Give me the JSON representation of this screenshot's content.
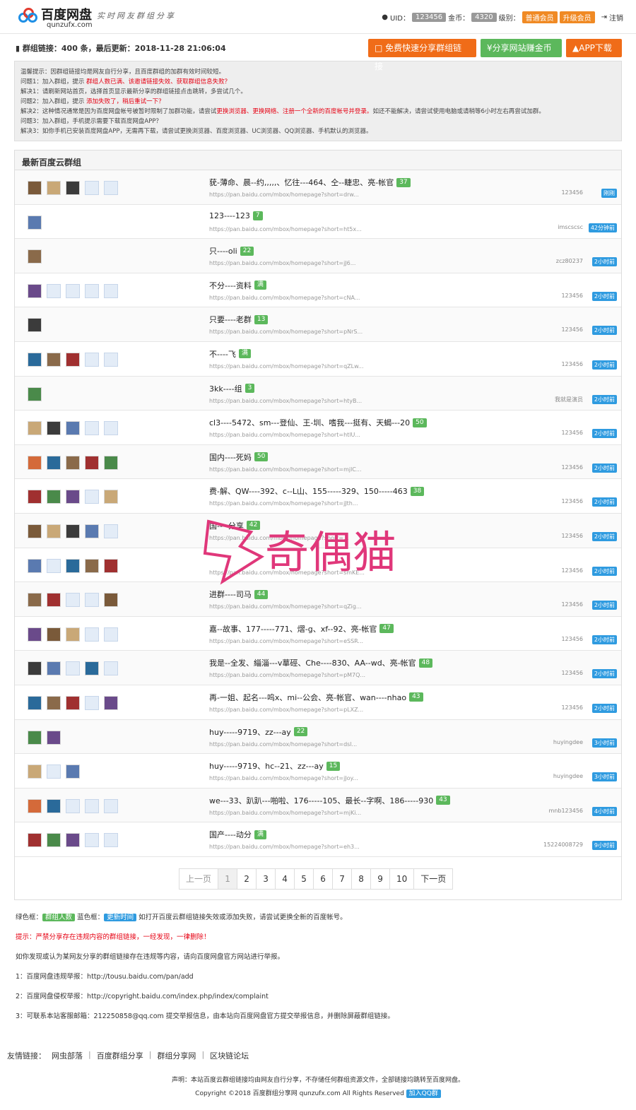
{
  "header": {
    "logo_title": "百度网盘",
    "logo_sub": "qunzufx.com",
    "slogan": "实时网友群组分享",
    "uid_label": "UID：",
    "uid": "123456",
    "coin_label": "金币：",
    "coins": "4320",
    "level_label": "级别：",
    "level": "普通会员",
    "upgrade": "升级会员",
    "logout": "注销"
  },
  "stats": {
    "text": "群组链接：400 条，最后更新：2018-11-28 21:06:04"
  },
  "top_buttons": {
    "share": "免费快速分享群组链接",
    "earn": "¥分享网站赚金币",
    "app": "APP下载"
  },
  "notice": [
    {
      "a": "温馨提示：因群组链接均是网友自行分享，且百度群组的加群有效时间较短。",
      "r": "",
      "b": ""
    },
    {
      "a": "问题1：加入群组，提示 ",
      "r": "群组人数已满、该邀请链接失效、获取群组信息失败？",
      "b": ""
    },
    {
      "a": "解决1：请刷新网站首页，选择首页显示最新分享的群组链接点击跳转，多尝试几个。",
      "r": "",
      "b": ""
    },
    {
      "a": "问题2：加入群组，提示 ",
      "r": "添加失败了，稍后重试一下？",
      "b": ""
    },
    {
      "a": "解决2：这种情况通常是因为百度网盘帐号被暂时限制了加群功能，请尝试",
      "r": "更换浏览器、更换网络、注册一个全新的百度帐号并登录。",
      "b": "如还不能解决，请尝试使用电脑或请稍等6小时左右再尝试加群。"
    },
    {
      "a": "问题3：加入群组，手机提示需要下载百度网盘APP？",
      "r": "",
      "b": ""
    },
    {
      "a": "解决3：如你手机已安装百度网盘APP，无需再下载，请尝试更换浏览器、百度浏览器、UC浏览器、QQ浏览器、手机默认的浏览器。",
      "r": "",
      "b": ""
    }
  ],
  "panel_title": "最新百度云群组",
  "groups": [
    {
      "name": "莸-薄命、晨--约,,,,,、忆往---464、仝--睫忠、亮-帐官",
      "count": "37",
      "link": "https://pan.baidu.com/mbox/homepage?short=drw...",
      "user": "123456",
      "time": "刚刚",
      "av": [
        "img",
        "img",
        "img",
        "blank",
        "blank"
      ]
    },
    {
      "name": "123----123",
      "count": "7",
      "link": "https://pan.baidu.com/mbox/homepage?short=ht5x...",
      "user": "imscscsc",
      "time": "42分钟前",
      "av": [
        "img"
      ]
    },
    {
      "name": "只----oli",
      "count": "22",
      "link": "https://pan.baidu.com/mbox/homepage?short=jJ6...",
      "user": "zcz80237",
      "time": "2小时前",
      "av": [
        "img"
      ]
    },
    {
      "name": "不分----资料",
      "count": "满",
      "link": "https://pan.baidu.com/mbox/homepage?short=cNA...",
      "user": "123456",
      "time": "2小时前",
      "av": [
        "img",
        "blank",
        "blank",
        "blank",
        "blank"
      ]
    },
    {
      "name": "只要----老群",
      "count": "13",
      "link": "https://pan.baidu.com/mbox/homepage?short=pNrS...",
      "user": "123456",
      "time": "2小时前",
      "av": [
        "img"
      ]
    },
    {
      "name": "不----飞",
      "count": "满",
      "link": "https://pan.baidu.com/mbox/homepage?short=qZLw...",
      "user": "123456",
      "time": "2小时前",
      "av": [
        "img",
        "img",
        "img",
        "blank",
        "blank"
      ]
    },
    {
      "name": "3kk----组",
      "count": "3",
      "link": "https://pan.baidu.com/mbox/homepage?short=htyB...",
      "user": "我就是演员",
      "time": "2小时前",
      "av": [
        "img"
      ]
    },
    {
      "name": "cl3----5472、sm---登仙、王-圳、嗜我---挺有、天蝎---20",
      "count": "50",
      "link": "https://pan.baidu.com/mbox/homepage?short=htlU...",
      "user": "123456",
      "time": "2小时前",
      "av": [
        "img",
        "img",
        "img",
        "blank",
        "blank"
      ]
    },
    {
      "name": "国内----死妈",
      "count": "50",
      "link": "https://pan.baidu.com/mbox/homepage?short=mjlC...",
      "user": "123456",
      "time": "2小时前",
      "av": [
        "img",
        "img",
        "img",
        "img",
        "img"
      ]
    },
    {
      "name": "费-解、QW----392、c--L山、155-----329、150-----463",
      "count": "38",
      "link": "https://pan.baidu.com/mbox/homepage?short=jJth...",
      "user": "123456",
      "time": "2小时前",
      "av": [
        "img",
        "img",
        "img",
        "blank",
        "img"
      ]
    },
    {
      "name": "国----分享",
      "count": "42",
      "link": "https://pan.baidu.com/mbox/homepage?short=...",
      "user": "123456",
      "time": "2小时前",
      "av": [
        "img",
        "img",
        "img",
        "img",
        "blank"
      ]
    },
    {
      "name": "",
      "count": "",
      "link": "https://pan.baidu.com/mbox/homepage?short=smKE...",
      "user": "123456",
      "time": "2小时前",
      "av": [
        "img",
        "blank",
        "img",
        "img",
        "img"
      ]
    },
    {
      "name": "进群----司马",
      "count": "44",
      "link": "https://pan.baidu.com/mbox/homepage?short=qZig...",
      "user": "123456",
      "time": "2小时前",
      "av": [
        "img",
        "img",
        "blank",
        "blank",
        "img"
      ]
    },
    {
      "name": "嘉--故事、177-----771、熠-g、xf--92、亮-帐官",
      "count": "47",
      "link": "https://pan.baidu.com/mbox/homepage?short=eSSR...",
      "user": "123456",
      "time": "2小时前",
      "av": [
        "img",
        "img",
        "img",
        "blank",
        "blank"
      ]
    },
    {
      "name": "我是--全发、緇淄---v蕐硜、Che----830、AA--wd、亮-帐官",
      "count": "48",
      "link": "https://pan.baidu.com/mbox/homepage?short=pM7Q...",
      "user": "123456",
      "time": "2小时前",
      "av": [
        "img",
        "img",
        "blank",
        "img",
        "blank"
      ]
    },
    {
      "name": "再-一姐、起名---呜x、mi--公会、亮-帐官、wan----nhao",
      "count": "43",
      "link": "https://pan.baidu.com/mbox/homepage?short=pLXZ...",
      "user": "123456",
      "time": "2小时前",
      "av": [
        "img",
        "img",
        "img",
        "blank",
        "img"
      ]
    },
    {
      "name": "huy-----9719、zz---ay",
      "count": "22",
      "link": "https://pan.baidu.com/mbox/homepage?short=dsl...",
      "user": "huyingdee",
      "time": "3小时前",
      "av": [
        "img",
        "img"
      ]
    },
    {
      "name": "huy-----9719、hc--21、zz---ay",
      "count": "15",
      "link": "https://pan.baidu.com/mbox/homepage?short=jJoy...",
      "user": "huyingdee",
      "time": "3小时前",
      "av": [
        "img",
        "blank",
        "img"
      ]
    },
    {
      "name": "we---33、趴趴---啪啦、176-----105、最长--字啊、186-----930",
      "count": "43",
      "link": "https://pan.baidu.com/mbox/homepage?short=mjKi...",
      "user": "mnb123456",
      "time": "4小时前",
      "av": [
        "img",
        "img",
        "blank",
        "blank",
        "blank"
      ]
    },
    {
      "name": "国产----动分",
      "count": "满",
      "link": "https://pan.baidu.com/mbox/homepage?short=eh3...",
      "user": "15224008729",
      "time": "9小时前",
      "av": [
        "img",
        "img",
        "img",
        "blank",
        "blank"
      ]
    }
  ],
  "pager": {
    "prev": "上一页",
    "next": "下一页",
    "pages": [
      "1",
      "2",
      "3",
      "4",
      "5",
      "6",
      "7",
      "8",
      "9",
      "10"
    ]
  },
  "notes": {
    "legend_a": "绿色框：",
    "legend_g": "群组人数",
    "legend_b": "蓝色框：",
    "legend_bl": "更新时间",
    "legend_c": "如打开百度云群组链接失效或添加失败，请尝试更换全新的百度帐号。",
    "warn": "提示：严禁分享存在违规内容的群组链接，一经发现，一律删除！",
    "line3": "如你发现或认为某网友分享的群组链接存在违规等内容，请向百度网盘官方网站进行举报。",
    "line4": "1：百度网盘违规举报：http://tousu.baidu.com/pan/add",
    "line5": "2：百度网盘侵权举报：http://copyright.baidu.com/index.php/index/complaint",
    "line6": "3：可联系本站客服邮箱：212250858@qq.com 提交举报信息，由本站向百度网盘官方提交举报信息，并删除屏蔽群组链接。"
  },
  "friends": {
    "label": "友情链接：",
    "links": [
      "网虫部落",
      "百度群组分享",
      "群组分享网",
      "区块链论坛"
    ]
  },
  "footer": {
    "statement": "声明：本站百度云群组链接均由网友自行分享，不存储任何群组资源文件，全部链接均跳转至百度网盘。",
    "copyright": "Copyright ©2018 百度群组分享网 qunzufx.com All Rights Reserved",
    "qq": "加入QQ群"
  },
  "watermark": "奇偶猫"
}
